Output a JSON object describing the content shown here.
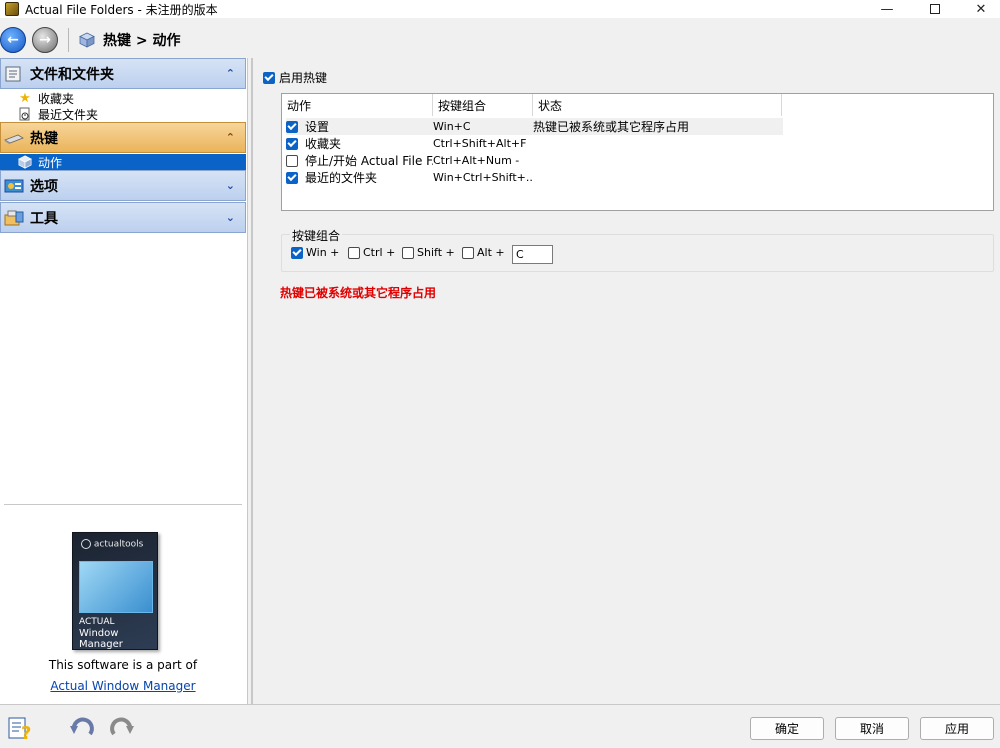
{
  "window": {
    "title": "Actual File Folders - 未注册的版本",
    "minimize": "—",
    "close": "✕"
  },
  "toolbar": {
    "breadcrumb": "热键 > 动作"
  },
  "sidebar": {
    "groups": [
      {
        "label": "文件和文件夹",
        "chevron": "⌃",
        "items": [
          {
            "label": "收藏夹",
            "icon": "star-icon"
          },
          {
            "label": "最近文件夹",
            "icon": "clock-doc-icon"
          }
        ]
      },
      {
        "label": "热键",
        "chevron": "⌃",
        "items": [
          {
            "label": "动作",
            "icon": "cube-icon"
          }
        ]
      },
      {
        "label": "选项",
        "chevron": "⌄",
        "items": []
      },
      {
        "label": "工具",
        "chevron": "⌄",
        "items": []
      }
    ],
    "promo": {
      "box_brand": "actualtools",
      "box_product_line1": "ACTUAL",
      "box_product_line2": "Window Manager",
      "text": "This software is a part of",
      "link": "Actual Window Manager"
    }
  },
  "main": {
    "enable_hotkeys": {
      "label": "启用热键",
      "checked": true
    },
    "table": {
      "columns": [
        "动作",
        "按键组合",
        "状态"
      ],
      "rows": [
        {
          "checked": true,
          "action": "设置",
          "combo": "Win+C",
          "status": "热键已被系统或其它程序占用"
        },
        {
          "checked": true,
          "action": "收藏夹",
          "combo": "Ctrl+Shift+Alt+F",
          "status": ""
        },
        {
          "checked": false,
          "action": "停止/开始 Actual File F...",
          "combo": "Ctrl+Alt+Num -",
          "status": ""
        },
        {
          "checked": true,
          "action": "最近的文件夹",
          "combo": "Win+Ctrl+Shift+...",
          "status": ""
        }
      ]
    },
    "combo_group": {
      "legend": "按键组合",
      "modifiers": [
        {
          "label": "Win +",
          "checked": true
        },
        {
          "label": "Ctrl +",
          "checked": false
        },
        {
          "label": "Shift +",
          "checked": false
        },
        {
          "label": "Alt +",
          "checked": false
        }
      ],
      "key_value": "C"
    },
    "warning": "热键已被系统或其它程序占用"
  },
  "footer": {
    "ok": "确定",
    "cancel": "取消",
    "apply": "应用"
  },
  "colors": {
    "accent": "#0b63c6",
    "selected_item": "#0a64c8",
    "warning": "#e00000",
    "active_group": "#eab45a"
  }
}
